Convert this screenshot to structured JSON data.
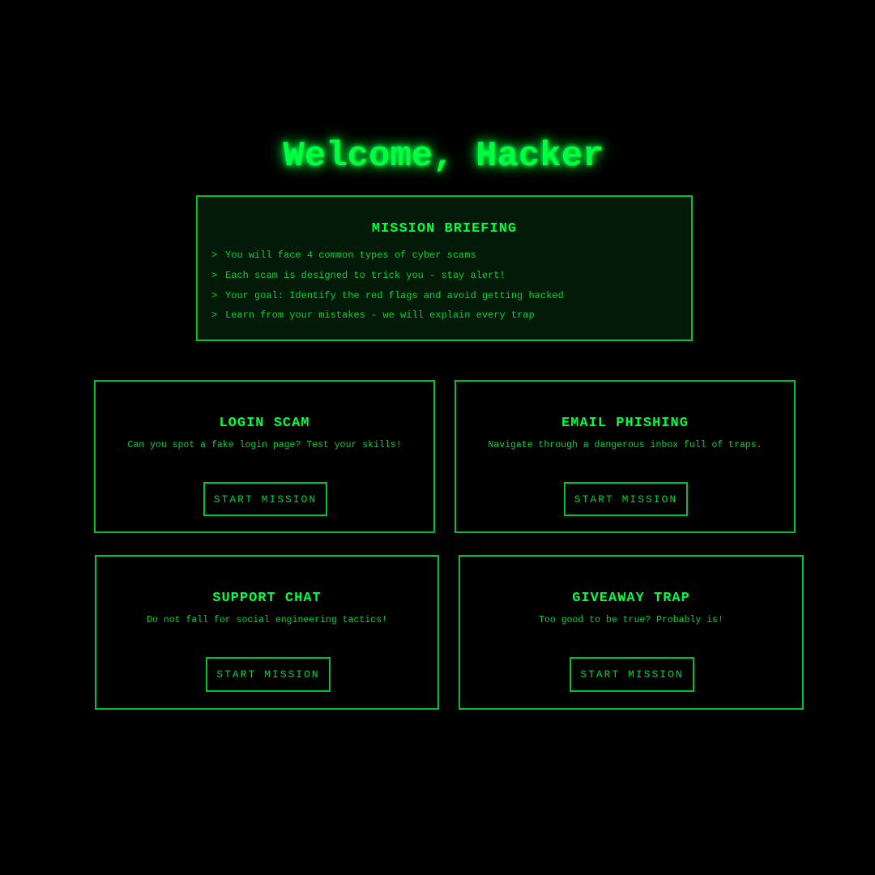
{
  "header": {
    "title": "Welcome, Hacker"
  },
  "briefing": {
    "title": "MISSION BRIEFING",
    "prompt_symbol": ">",
    "items": [
      "You will face 4 common types of cyber scams",
      "Each scam is designed to trick you - stay alert!",
      "Your goal: Identify the red flags and avoid getting hacked",
      "Learn from your mistakes - we will explain every trap"
    ]
  },
  "missions": [
    {
      "title": "LOGIN SCAM",
      "description": "Can you spot a fake login page? Test your skills!",
      "button_label": "START MISSION"
    },
    {
      "title": "EMAIL PHISHING",
      "description": "Navigate through a dangerous inbox full of traps.",
      "button_label": "START MISSION"
    },
    {
      "title": "SUPPORT CHAT",
      "description": "Do not fall for social engineering tactics!",
      "button_label": "START MISSION"
    },
    {
      "title": "GIVEAWAY TRAP",
      "description": "Too good to be true? Probably is!",
      "button_label": "START MISSION"
    }
  ],
  "colors": {
    "background": "#000000",
    "accent": "#00ff41",
    "border": "#00c22e",
    "text": "#00d436",
    "panel": "#041a08"
  }
}
